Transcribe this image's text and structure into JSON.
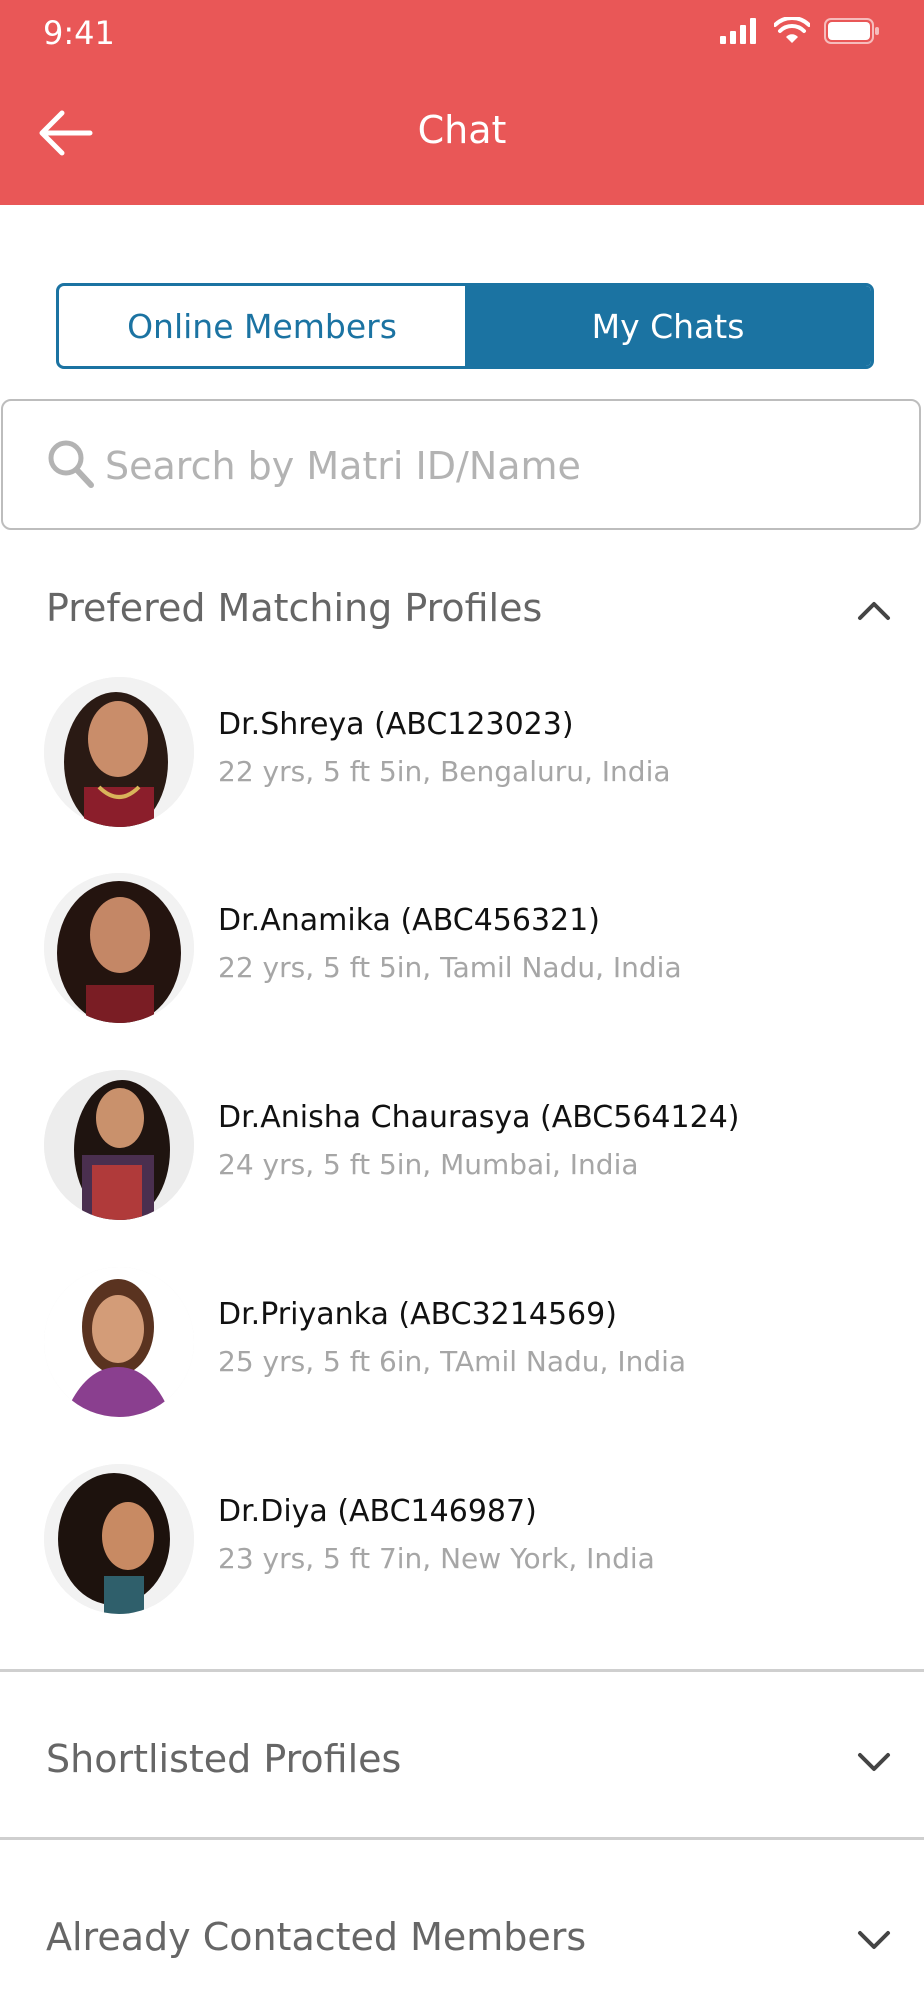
{
  "status_bar": {
    "time": "9:41"
  },
  "header": {
    "title": "Chat",
    "bg_color": "#E95757"
  },
  "tabs": [
    {
      "label": "Online Members",
      "active": false
    },
    {
      "label": "My Chats",
      "active": true
    }
  ],
  "accent_color": "#1B73A2",
  "search": {
    "placeholder": "Search by Matri ID/Name",
    "value": ""
  },
  "sections": [
    {
      "title": "Prefered Matching Profiles",
      "expanded": true,
      "profiles": [
        {
          "name": "Dr.Shreya (ABC123023)",
          "details": "22 yrs, 5 ft 5in, Bengaluru, India"
        },
        {
          "name": "Dr.Anamika (ABC456321)",
          "details": "22 yrs, 5 ft 5in, Tamil Nadu, India"
        },
        {
          "name": "Dr.Anisha Chaurasya (ABC564124)",
          "details": "24 yrs, 5 ft 5in, Mumbai, India"
        },
        {
          "name": "Dr.Priyanka (ABC3214569)",
          "details": "25 yrs, 5 ft 6in, TAmil Nadu, India"
        },
        {
          "name": "Dr.Diya (ABC146987)",
          "details": "23 yrs, 5 ft 7in, New York, India"
        }
      ]
    },
    {
      "title": "Shortlisted Profiles",
      "expanded": false
    },
    {
      "title": "Already Contacted Members",
      "expanded": false
    }
  ]
}
